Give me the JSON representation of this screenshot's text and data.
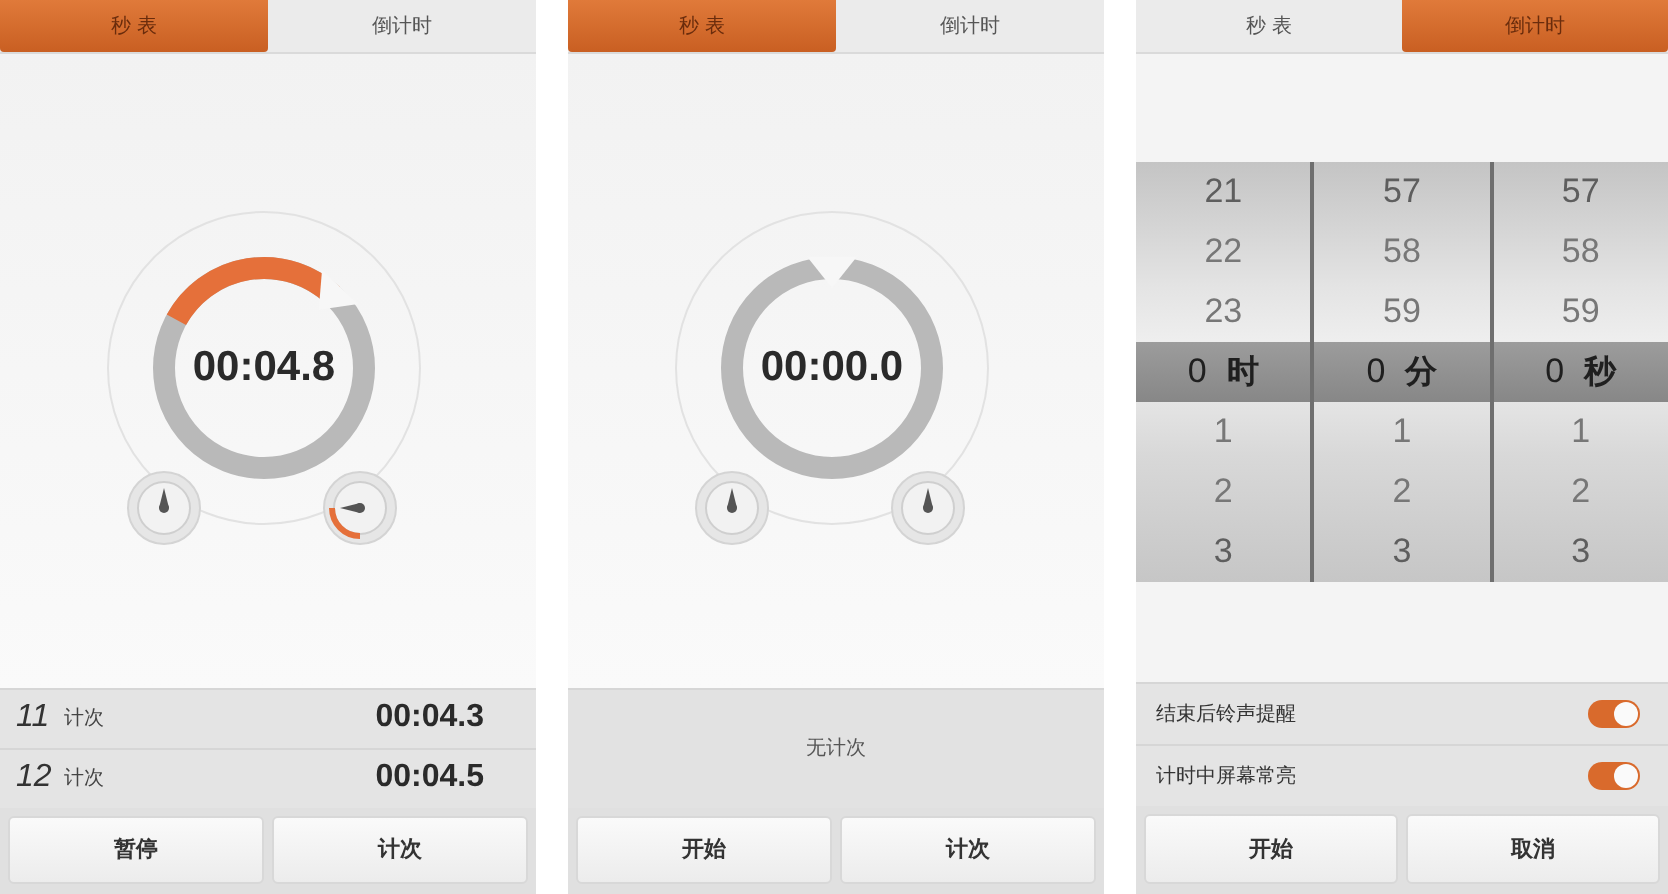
{
  "screens": [
    {
      "kind": "stopwatch",
      "tabs": [
        {
          "label": "秒 表",
          "selected": true
        },
        {
          "label": "倒计时",
          "selected": false
        }
      ],
      "time": "00:04.8",
      "ring": {
        "running": true
      },
      "subdials": [
        {
          "running": false
        },
        {
          "running": true
        }
      ],
      "laps": [
        {
          "number": "11",
          "label": "计次",
          "time": "00:04.3"
        },
        {
          "number": "12",
          "label": "计次",
          "time": "00:04.5"
        }
      ],
      "buttons": [
        "暂停",
        "计次"
      ]
    },
    {
      "kind": "stopwatch",
      "tabs": [
        {
          "label": "秒 表",
          "selected": true
        },
        {
          "label": "倒计时",
          "selected": false
        }
      ],
      "time": "00:00.0",
      "ring": {
        "running": false
      },
      "subdials": [
        {
          "running": false
        },
        {
          "running": false
        }
      ],
      "empty_text": "无计次",
      "buttons": [
        "开始",
        "计次"
      ]
    },
    {
      "kind": "countdown",
      "tabs": [
        {
          "label": "秒 表",
          "selected": false
        },
        {
          "label": "倒计时",
          "selected": true
        }
      ],
      "picker": [
        {
          "above": [
            "21",
            "22",
            "23"
          ],
          "value": "0",
          "unit": "时",
          "below": [
            "1",
            "2",
            "3"
          ]
        },
        {
          "above": [
            "57",
            "58",
            "59"
          ],
          "value": "0",
          "unit": "分",
          "below": [
            "1",
            "2",
            "3"
          ]
        },
        {
          "above": [
            "57",
            "58",
            "59"
          ],
          "value": "0",
          "unit": "秒",
          "below": [
            "1",
            "2",
            "3"
          ]
        }
      ],
      "settings": [
        {
          "label": "结束后铃声提醒",
          "on": true
        },
        {
          "label": "计时中屏幕常亮",
          "on": true
        }
      ],
      "buttons": [
        "开始",
        "取消"
      ]
    }
  ]
}
